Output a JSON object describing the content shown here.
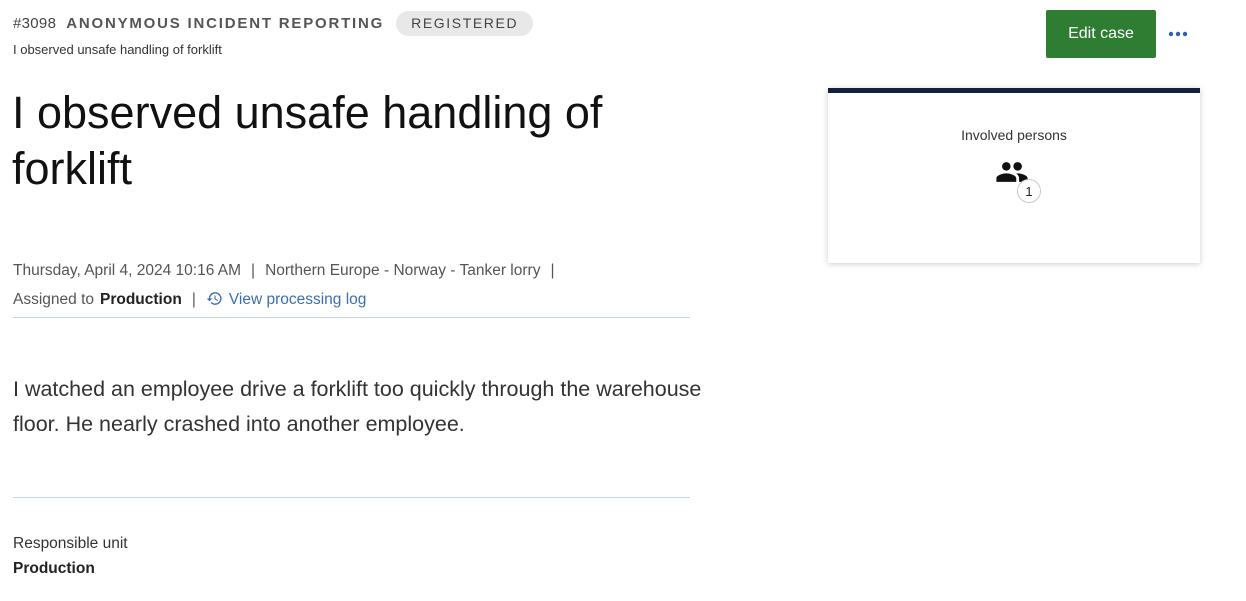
{
  "header": {
    "case_id": "#3098",
    "case_type": "ANONYMOUS INCIDENT REPORTING",
    "status": "REGISTERED",
    "subtitle": "I observed unsafe handling of forklift"
  },
  "title": "I observed unsafe handling of forklift",
  "meta": {
    "datetime": "Thursday, April 4, 2024 10:16 AM",
    "location": "Northern Europe - Norway - Tanker lorry",
    "assigned_label": "Assigned to",
    "assigned_value": "Production",
    "log_link": "View processing log",
    "separator": "|"
  },
  "description": "I watched an employee drive a forklift too quickly through the warehouse floor. He nearly crashed into another employee.",
  "fields": {
    "responsible_unit_label": "Responsible unit",
    "responsible_unit_value": "Production"
  },
  "actions": {
    "edit_label": "Edit case",
    "more_icon": "more-horizontal-icon"
  },
  "involved_card": {
    "label": "Involved persons",
    "count": "1",
    "icon": "people-icon"
  },
  "colors": {
    "primary_button": "#2e7d32",
    "link": "#3b6fb0",
    "card_accent": "#14213d"
  }
}
